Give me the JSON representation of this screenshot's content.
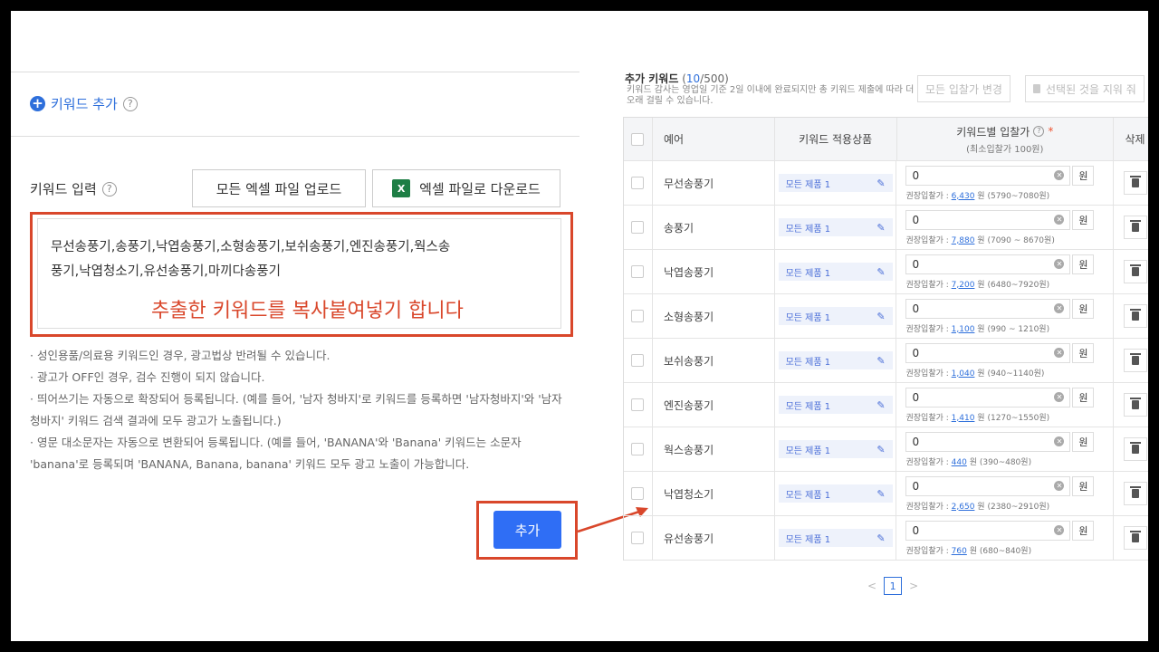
{
  "left": {
    "add_keyword_label": "키워드 추가",
    "keyword_input_label": "키워드 입력",
    "upload_excel_label": "모든 엑셀 파일 업로드",
    "download_excel_label": "엑셀 파일로 다운로드",
    "excel_icon_text": "X",
    "textarea_line1": "무선송풍기,송풍기,낙엽송풍기,소형송풍기,보쉬송풍기,엔진송풍기,웍스송",
    "textarea_line2": "풍기,낙엽청소기,유선송풍기,마끼다송풍기",
    "overlay_note": "추출한 키워드를 복사붙여넣기 합니다",
    "notes": [
      "· 성인용품/의료용 키워드인 경우, 광고법상 반려될 수 있습니다.",
      "· 광고가 OFF인 경우, 검수 진행이 되지 않습니다.",
      "· 띄어쓰기는 자동으로 확장되어 등록됩니다. (예를 들어, '남자 청바지'로 키워드를 등록하면 '남자청바지'와 '남자 청바지' 키워드 검색 결과에 모두 광고가 노출됩니다.)",
      "· 영문 대소문자는 자동으로 변환되어 등록됩니다. (예를 들어, 'BANANA'와 'Banana' 키워드는 소문자 'banana'로 등록되며 'BANANA, Banana, banana' 키워드 모두 광고 노출이 가능합니다."
    ],
    "add_button_label": "추가"
  },
  "right": {
    "title": "추가 키워드",
    "count_open": " (",
    "count_value": "10",
    "count_close": "/500)",
    "description": "키워드 감사는 영업일 기준 2일 이내에 완료되지만 총 키워드 제출에 따라 더 오래 걸릴 수 있습니다.",
    "change_all_bids_label": "모든 입찰가 변경",
    "delete_selected_label": "선택된 것을 지워 줘",
    "columns": {
      "keyword": "예어",
      "product": "키워드 적용상품",
      "bid": "키워드별 입찰가",
      "bid_required": "*",
      "bid_sub": "(최소입찰가 100원)",
      "delete": "삭제"
    },
    "rec_label": "권장입찰가 :",
    "rec_unit": "원",
    "unit_button": "원",
    "rows": [
      {
        "keyword": "무선송풍기",
        "product": "모든 제품 1",
        "bid": "0",
        "rec": "6,430",
        "range": "(5790~7080원)"
      },
      {
        "keyword": "송풍기",
        "product": "모든 제품 1",
        "bid": "0",
        "rec": "7,880",
        "range": "(7090 ~ 8670원)"
      },
      {
        "keyword": "낙엽송풍기",
        "product": "모든 제품 1",
        "bid": "0",
        "rec": "7,200",
        "range": "(6480~7920원)"
      },
      {
        "keyword": "소형송풍기",
        "product": "모든 제품 1",
        "bid": "0",
        "rec": "1,100",
        "range": "(990 ~ 1210원)"
      },
      {
        "keyword": "보쉬송풍기",
        "product": "모든 제품 1",
        "bid": "0",
        "rec": "1,040",
        "range": "(940~1140원)"
      },
      {
        "keyword": "엔진송풍기",
        "product": "모든 제품 1",
        "bid": "0",
        "rec": "1,410",
        "range": "(1270~1550원)"
      },
      {
        "keyword": "웍스송풍기",
        "product": "모든 제품 1",
        "bid": "0",
        "rec": "440",
        "range": "(390~480원)"
      },
      {
        "keyword": "낙엽청소기",
        "product": "모든 제품 1",
        "bid": "0",
        "rec": "2,650",
        "range": "(2380~2910원)"
      },
      {
        "keyword": "유선송풍기",
        "product": "모든 제품 1",
        "bid": "0",
        "rec": "760",
        "range": "(680~840원)"
      }
    ],
    "pager": {
      "prev": "<",
      "page": "1",
      "next": ">"
    }
  },
  "colors": {
    "accent": "#2f6ef5",
    "highlight": "#d9472b",
    "excel": "#1e7e45"
  }
}
